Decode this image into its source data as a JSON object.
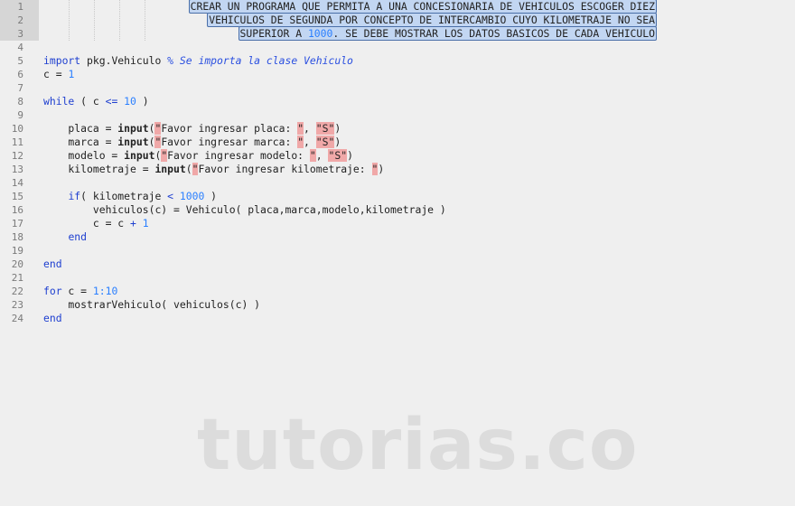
{
  "editor": {
    "line_numbers": [
      1,
      2,
      3,
      4,
      5,
      6,
      7,
      8,
      9,
      10,
      11,
      12,
      13,
      14,
      15,
      16,
      17,
      18,
      19,
      20,
      21,
      22,
      23,
      24
    ],
    "lines": [
      {
        "sel": true,
        "tokens": [
          [
            "t",
            "CREAR UN PROGRAMA QUE PERMITA A UNA CONCESIONARIA DE VEHICULOS ESCOGER DIEZ"
          ]
        ]
      },
      {
        "sel": true,
        "tokens": [
          [
            "t",
            "VEHICULOS DE SEGUNDA POR CONCEPTO DE INTERCAMBIO CUYO KILOMETRAJE NO SEA"
          ]
        ]
      },
      {
        "sel": true,
        "tokens": [
          [
            "t",
            "SUPERIOR A "
          ],
          [
            "num",
            "1000"
          ],
          [
            "t",
            ". SE DEBE MOSTRAR LOS DATOS BASICOS DE CADA VEHICULO"
          ]
        ]
      },
      {
        "tokens": []
      },
      {
        "tokens": [
          [
            "kw",
            "import"
          ],
          [
            "t",
            " pkg.Vehiculo "
          ],
          [
            "cmt",
            "% Se importa la clase Vehiculo"
          ]
        ]
      },
      {
        "tokens": [
          [
            "t",
            "c = "
          ],
          [
            "num",
            "1"
          ]
        ]
      },
      {
        "tokens": []
      },
      {
        "tokens": [
          [
            "kw",
            "while"
          ],
          [
            "t",
            " ( c "
          ],
          [
            "kw",
            "<="
          ],
          [
            "t",
            " "
          ],
          [
            "num",
            "10"
          ],
          [
            "t",
            " )"
          ]
        ]
      },
      {
        "tokens": []
      },
      {
        "tokens": [
          [
            "t",
            "    placa = "
          ],
          [
            "bold",
            "input"
          ],
          [
            "t",
            "("
          ],
          [
            "q",
            "\""
          ],
          [
            "t",
            "Favor ingresar placa: "
          ],
          [
            "q",
            "\""
          ],
          [
            "t",
            ", "
          ],
          [
            "q",
            "\"S\""
          ],
          [
            "t",
            ")"
          ]
        ]
      },
      {
        "tokens": [
          [
            "t",
            "    marca = "
          ],
          [
            "bold",
            "input"
          ],
          [
            "t",
            "("
          ],
          [
            "q",
            "\""
          ],
          [
            "t",
            "Favor ingresar marca: "
          ],
          [
            "q",
            "\""
          ],
          [
            "t",
            ", "
          ],
          [
            "q",
            "\"S\""
          ],
          [
            "t",
            ")"
          ]
        ]
      },
      {
        "tokens": [
          [
            "t",
            "    modelo = "
          ],
          [
            "bold",
            "input"
          ],
          [
            "t",
            "("
          ],
          [
            "q",
            "\""
          ],
          [
            "t",
            "Favor ingresar modelo: "
          ],
          [
            "q",
            "\""
          ],
          [
            "t",
            ", "
          ],
          [
            "q",
            "\"S\""
          ],
          [
            "t",
            ")"
          ]
        ]
      },
      {
        "tokens": [
          [
            "t",
            "    kilometraje = "
          ],
          [
            "bold",
            "input"
          ],
          [
            "t",
            "("
          ],
          [
            "q",
            "\""
          ],
          [
            "t",
            "Favor ingresar kilometraje: "
          ],
          [
            "q",
            "\""
          ],
          [
            "t",
            ")"
          ]
        ]
      },
      {
        "tokens": []
      },
      {
        "tokens": [
          [
            "t",
            "    "
          ],
          [
            "kw",
            "if"
          ],
          [
            "t",
            "( kilometraje "
          ],
          [
            "kw",
            "<"
          ],
          [
            "t",
            " "
          ],
          [
            "num",
            "1000"
          ],
          [
            "t",
            " )"
          ]
        ]
      },
      {
        "tokens": [
          [
            "t",
            "        vehiculos(c) = Vehiculo( placa,marca,modelo,kilometraje )"
          ]
        ]
      },
      {
        "tokens": [
          [
            "t",
            "        c = c "
          ],
          [
            "kw",
            "+"
          ],
          [
            "t",
            " "
          ],
          [
            "num",
            "1"
          ]
        ]
      },
      {
        "tokens": [
          [
            "t",
            "    "
          ],
          [
            "kw",
            "end"
          ]
        ]
      },
      {
        "tokens": []
      },
      {
        "tokens": [
          [
            "kw",
            "end"
          ]
        ]
      },
      {
        "tokens": []
      },
      {
        "tokens": [
          [
            "kw",
            "for"
          ],
          [
            "t",
            " c = "
          ],
          [
            "num",
            "1:10"
          ]
        ]
      },
      {
        "tokens": [
          [
            "t",
            "    mostrarVehiculo( vehiculos(c) )"
          ]
        ]
      },
      {
        "tokens": [
          [
            "kw",
            "end"
          ]
        ]
      }
    ]
  },
  "watermark": "tutorias.co"
}
